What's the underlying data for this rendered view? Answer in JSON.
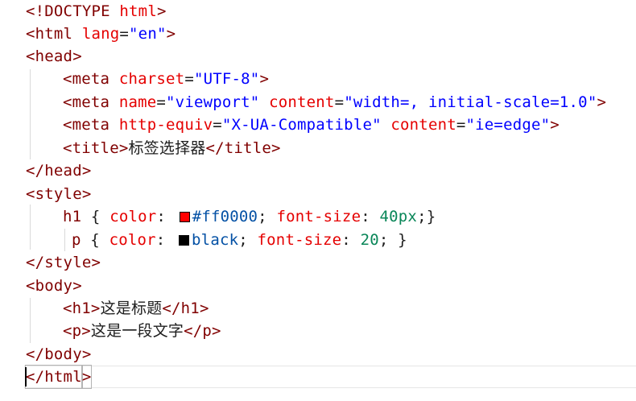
{
  "editor": {
    "lines": [
      {
        "tokens": [
          "<!DOCTYPE",
          "html",
          ">"
        ]
      },
      {
        "tokens": [
          "<html",
          "lang",
          "=",
          "\"en\"",
          ">"
        ]
      },
      {
        "tokens": [
          "<head",
          ">"
        ]
      },
      {
        "tokens": [
          "<meta",
          "charset",
          "=",
          "\"UTF-8\"",
          ">"
        ]
      },
      {
        "tokens": [
          "<meta",
          "name",
          "=",
          "\"viewport\"",
          "content",
          "=",
          "\"width=, initial-scale=1.0\"",
          ">"
        ]
      },
      {
        "tokens": [
          "<meta",
          "http-equiv",
          "=",
          "\"X-UA-Compatible\"",
          "content",
          "=",
          "\"ie=edge\"",
          ">"
        ]
      },
      {
        "tokens": [
          "<title",
          ">",
          "标签选择器",
          "</title",
          ">"
        ]
      },
      {
        "tokens": [
          "</head",
          ">"
        ]
      },
      {
        "tokens": [
          "<style",
          ">"
        ]
      },
      {
        "tokens": [
          "h1",
          "{",
          "color",
          ":",
          "#ff0000",
          ";",
          "font-size",
          ":",
          "40px",
          ";}"
        ]
      },
      {
        "tokens": [
          "p",
          "{",
          "color",
          ":",
          "black",
          ";",
          "font-size",
          ":",
          "20",
          ";",
          "}"
        ]
      },
      {
        "tokens": [
          "</style",
          ">"
        ]
      },
      {
        "tokens": [
          "<body",
          ">"
        ]
      },
      {
        "tokens": [
          "<h1",
          ">",
          "这是标题",
          "</h1",
          ">"
        ]
      },
      {
        "tokens": [
          "<p",
          ">",
          "这是一段文字",
          "</p",
          ">"
        ]
      },
      {
        "tokens": [
          "</body",
          ">"
        ]
      },
      {
        "tokens": [
          "</html",
          ">"
        ]
      }
    ],
    "swatches": {
      "h1_color": "#ff0000",
      "p_color": "#000000"
    }
  },
  "colors": {
    "tag": "#800000",
    "attribute": "#e50000",
    "string": "#0000ff",
    "number": "#098658",
    "value": "#0451a5"
  }
}
